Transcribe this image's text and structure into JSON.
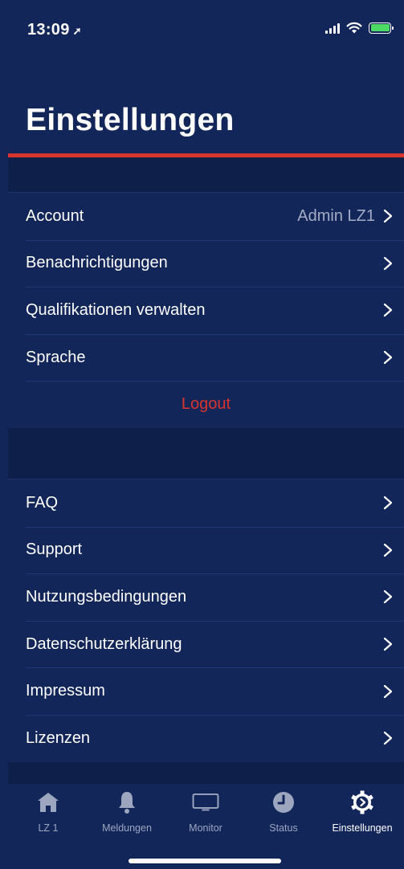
{
  "status_bar": {
    "time": "13:09",
    "battery_color": "#4CD964"
  },
  "header": {
    "title": "Einstellungen",
    "accent_color": "#D8342E"
  },
  "account_section": {
    "items": [
      {
        "label": "Account",
        "value": "Admin LZ1",
        "icon": "chevron-right-icon"
      },
      {
        "label": "Benachrichtigungen",
        "value": "",
        "icon": "chevron-right-icon"
      },
      {
        "label": "Qualifikationen verwalten",
        "value": "",
        "icon": "chevron-right-icon"
      },
      {
        "label": "Sprache",
        "value": "",
        "icon": "chevron-right-icon"
      }
    ],
    "logout_label": "Logout"
  },
  "info_section": {
    "items": [
      {
        "label": "FAQ",
        "icon": "chevron-right-icon"
      },
      {
        "label": "Support",
        "icon": "chevron-right-icon"
      },
      {
        "label": "Nutzungsbedingungen",
        "icon": "chevron-right-icon"
      },
      {
        "label": "Datenschutzerklärung",
        "icon": "chevron-right-icon"
      },
      {
        "label": "Impressum",
        "icon": "chevron-right-icon"
      },
      {
        "label": "Lizenzen",
        "icon": "chevron-right-icon"
      }
    ]
  },
  "tab_bar": {
    "active_tab": "Einstellungen",
    "tabs": [
      {
        "label": "LZ 1",
        "icon": "home-icon"
      },
      {
        "label": "Meldungen",
        "icon": "bell-icon"
      },
      {
        "label": "Monitor",
        "icon": "monitor-icon"
      },
      {
        "label": "Status",
        "icon": "clock-icon"
      },
      {
        "label": "Einstellungen",
        "icon": "gear-icon"
      }
    ]
  },
  "colors": {
    "background": "#13265A",
    "section_spacer": "#0E2049",
    "logout": "#D8342E",
    "secondary_text": "#A3ACC4"
  }
}
